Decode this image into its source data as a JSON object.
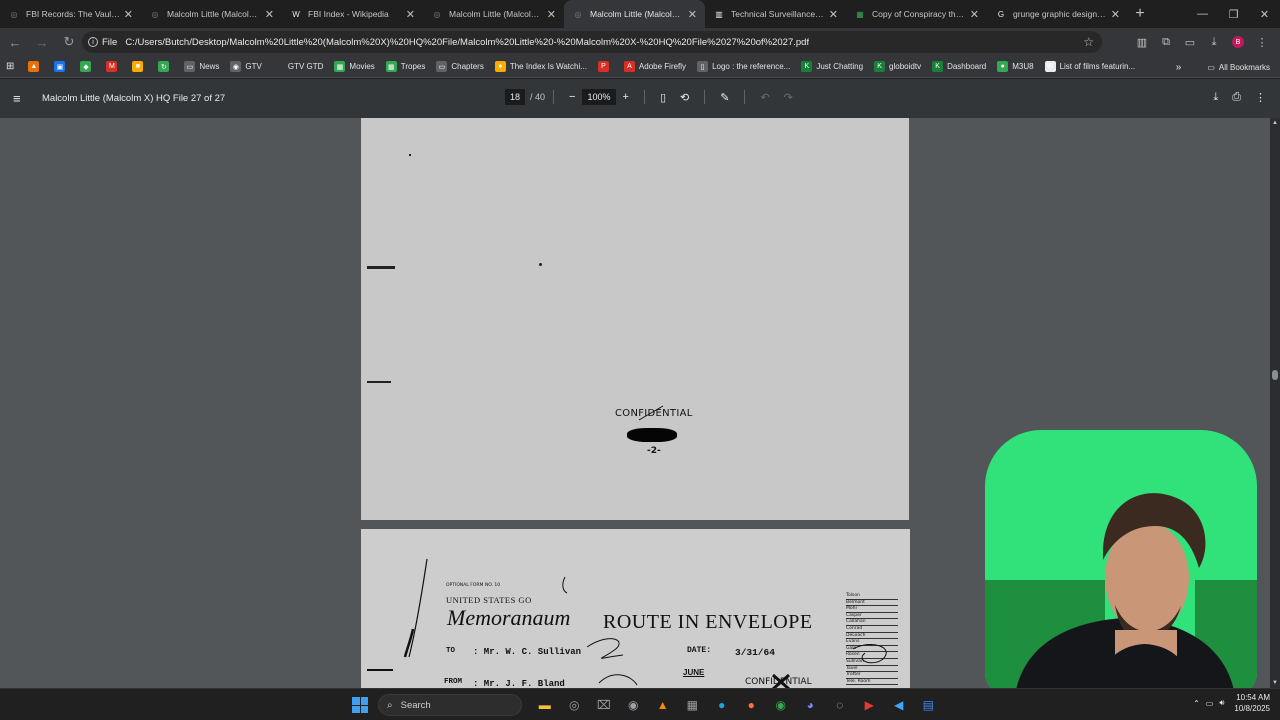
{
  "tabs": [
    {
      "label": "FBI Records: The Vault — M",
      "color": "#7a7d82",
      "glyph": "◎",
      "active": false
    },
    {
      "label": "Malcolm Little (Malcolm X",
      "color": "#7a7d82",
      "glyph": "◎",
      "active": false
    },
    {
      "label": "FBI Index - Wikipedia",
      "color": "#e8eaed",
      "glyph": "W",
      "active": false
    },
    {
      "label": "Malcolm Little (Malcolm X",
      "color": "#7a7d82",
      "glyph": "◎",
      "active": false
    },
    {
      "label": "Malcolm Little (Malcolm X",
      "color": "#7a7d82",
      "glyph": "◎",
      "active": true
    },
    {
      "label": "Technical Surveillance (TE",
      "color": "#e8eaed",
      "glyph": "▥",
      "active": false
    },
    {
      "label": "Copy of Conspiracy theory",
      "color": "#34a853",
      "glyph": "▦",
      "active": false
    },
    {
      "label": "grunge graphic design ass",
      "color": "#e8eaed",
      "glyph": "G",
      "active": false
    }
  ],
  "address": {
    "scheme": "File",
    "url": "C:/Users/Butch/Desktop/Malcolm%20Little%20(Malcolm%20X)%20HQ%20File/Malcolm%20Little%20-%20Malcolm%20X-%20HQ%20File%2027%20of%2027.pdf"
  },
  "profile_initial": "B",
  "bookmarks": [
    {
      "label": "",
      "color": "#e8710a",
      "glyph": "▲"
    },
    {
      "label": "",
      "color": "#1a73e8",
      "glyph": "▣"
    },
    {
      "label": "",
      "color": "#34a853",
      "glyph": "◆"
    },
    {
      "label": "",
      "color": "#d93025",
      "glyph": "M"
    },
    {
      "label": "",
      "color": "#f9ab00",
      "glyph": "■"
    },
    {
      "label": "",
      "color": "#34a853",
      "glyph": "↻"
    },
    {
      "label": "News",
      "color": "#5f6368",
      "glyph": "▭"
    },
    {
      "label": "GTV",
      "color": "#5f6368",
      "glyph": "◉"
    },
    {
      "label": "GTV GTD",
      "color": "#35363a",
      "glyph": ""
    },
    {
      "label": "Movies",
      "color": "#34a853",
      "glyph": "▦"
    },
    {
      "label": "Tropes",
      "color": "#34a853",
      "glyph": "▦"
    },
    {
      "label": "Chapters",
      "color": "#5f6368",
      "glyph": "▭"
    },
    {
      "label": "The Index Is Watchi...",
      "color": "#f9ab00",
      "glyph": "●"
    },
    {
      "label": "",
      "color": "#d93025",
      "glyph": "P"
    },
    {
      "label": "Adobe Firefly",
      "color": "#d93025",
      "glyph": "A"
    },
    {
      "label": "Logo : the reference...",
      "color": "#5f6368",
      "glyph": "▯"
    },
    {
      "label": "Just Chatting",
      "color": "#188038",
      "glyph": "K"
    },
    {
      "label": "globoidtv",
      "color": "#188038",
      "glyph": "K"
    },
    {
      "label": "Dashboard",
      "color": "#188038",
      "glyph": "K"
    },
    {
      "label": "M3U8",
      "color": "#34a853",
      "glyph": "●"
    },
    {
      "label": "List of films featurin...",
      "color": "#e8eaed",
      "glyph": "W"
    }
  ],
  "all_bookmarks_label": "All Bookmarks",
  "pdf": {
    "title": "Malcolm Little (Malcolm X) HQ File 27 of 27",
    "current_page": "18",
    "total_pages": "/ 40",
    "zoom": "100%"
  },
  "page1": {
    "stamp": "CONFIDENTIAL",
    "page_number": "-2-"
  },
  "page2": {
    "form_number": "OPTIONAL FORM NO. 10",
    "agency": "UNITED STATES GO",
    "heading": "Memoranaum",
    "route": "ROUTE IN ENVELOPE",
    "to_label": "TO",
    "to_value": ":  Mr. W. C. Sullivan",
    "date_label": "DATE:",
    "date_value": "3/31/64",
    "from_label": "FROM",
    "from_value": ":  Mr. J. F. Bland",
    "june": "JUNE",
    "stamp": "CONFIDENTIAL",
    "routing_list": [
      "Tolson",
      "Belmont",
      "Mohr",
      "Casper",
      "Callahan",
      "Conrad",
      "DeLoach",
      "Evans",
      "Gale",
      "Rosen",
      "Sullivan",
      "Tavel",
      "Trotter",
      "Tele. Room"
    ]
  },
  "taskbar": {
    "search_label": "Search",
    "icons": [
      {
        "name": "file-explorer-icon",
        "color": "#f9c13a",
        "glyph": "▬"
      },
      {
        "name": "app-icon",
        "color": "#9aa0a6",
        "glyph": "◎"
      },
      {
        "name": "terminal-icon",
        "color": "#9aa0a6",
        "glyph": "⌧"
      },
      {
        "name": "4k-downloader-icon",
        "color": "#9aa0a6",
        "glyph": "◉"
      },
      {
        "name": "vlc-icon",
        "color": "#f28b00",
        "glyph": "▲"
      },
      {
        "name": "calculator-icon",
        "color": "#9aa0a6",
        "glyph": "▦"
      },
      {
        "name": "edge-icon",
        "color": "#1fa2e0",
        "glyph": "●"
      },
      {
        "name": "firefox-icon",
        "color": "#ff7139",
        "glyph": "●"
      },
      {
        "name": "chrome-icon",
        "color": "#34a853",
        "glyph": "◉"
      },
      {
        "name": "discord-icon",
        "color": "#7c86f7",
        "glyph": "◕"
      },
      {
        "name": "obs-icon",
        "color": "#c4c7c5",
        "glyph": "◌"
      },
      {
        "name": "media-icon",
        "color": "#e53935",
        "glyph": "▶"
      },
      {
        "name": "vscode-icon",
        "color": "#3ea6ff",
        "glyph": "◀"
      },
      {
        "name": "notes-icon",
        "color": "#4285f4",
        "glyph": "▤"
      }
    ],
    "time": "10:54 AM",
    "date": "10/8/2025"
  }
}
